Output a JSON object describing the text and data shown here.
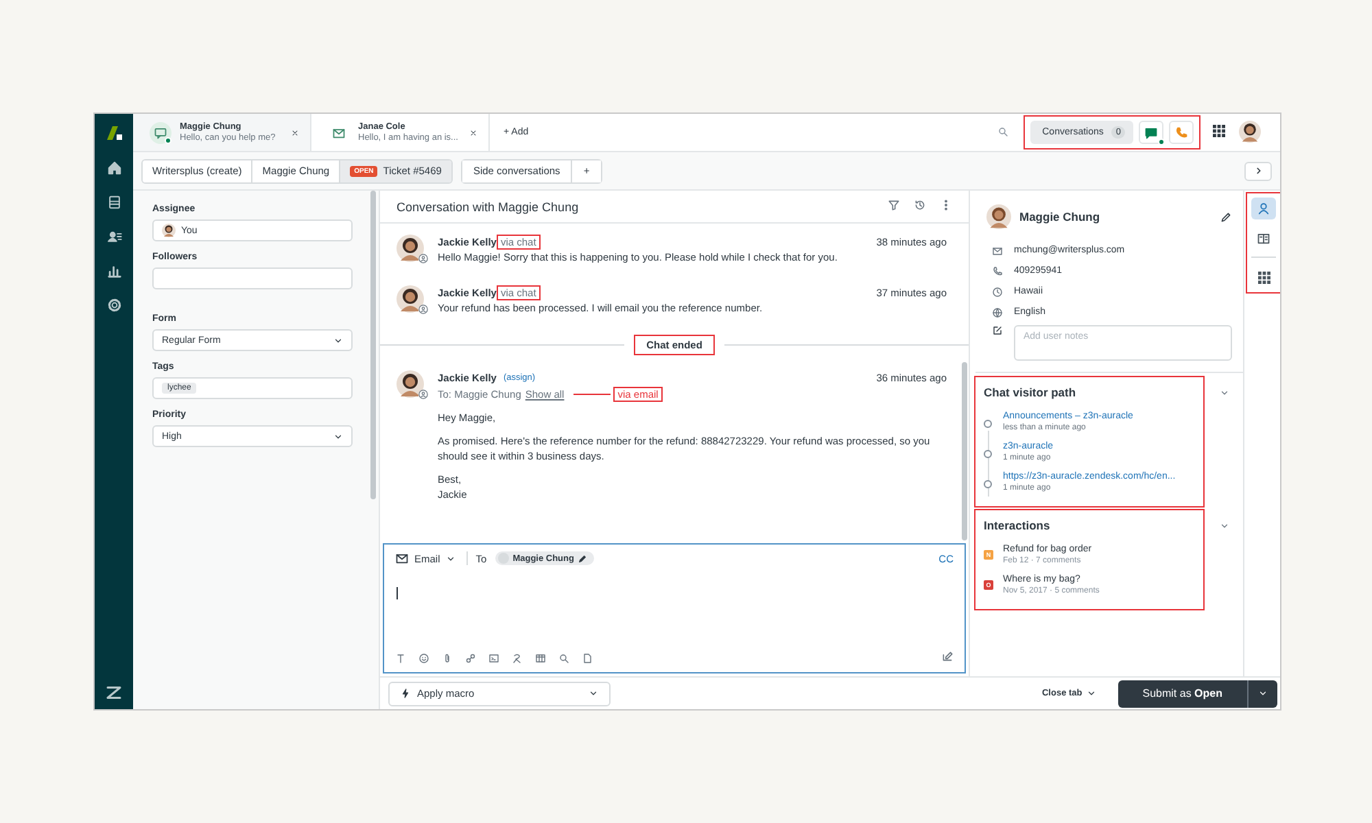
{
  "tabs": [
    {
      "kind": "chat",
      "title": "Maggie Chung",
      "preview": "Hello, can you help me?",
      "selected": true,
      "online": true
    },
    {
      "kind": "email",
      "title": "Janae Cole",
      "preview": "Hello, I am having an is...",
      "selected": false,
      "online": false
    }
  ],
  "add_tab": "+ Add",
  "conversations": {
    "label": "Conversations",
    "count": "0",
    "highlighted": true,
    "chat_online": true
  },
  "breadcrumbs": [
    {
      "label": "Writersplus (create)",
      "selected": false
    },
    {
      "label": "Maggie Chung",
      "selected": false
    },
    {
      "label": "Ticket #5469",
      "badge": "OPEN",
      "selected": true
    }
  ],
  "side_conversations": {
    "label": "Side conversations",
    "add": "+"
  },
  "properties": [
    {
      "kind": "person",
      "label": "Assignee",
      "value": "You"
    },
    {
      "kind": "text",
      "label": "Followers"
    },
    {
      "kind": "select",
      "label": "Form",
      "value": "Regular Form"
    },
    {
      "kind": "tags",
      "label": "Tags",
      "tags": [
        "lychee"
      ]
    },
    {
      "kind": "select",
      "label": "Priority",
      "value": "High"
    }
  ],
  "conversation": {
    "title": "Conversation with Maggie Chung",
    "messages": [
      {
        "kind": "chat",
        "author": "Jackie Kelly",
        "via": "via chat",
        "via_highlighted": true,
        "time": "38 minutes ago",
        "text": "Hello Maggie! Sorry that this is happening to you. Please hold while I check that for you."
      },
      {
        "kind": "chat",
        "author": "Jackie Kelly",
        "via": "via chat",
        "via_highlighted": true,
        "time": "37 minutes ago",
        "text": "Your refund has been processed. I will email you the reference number."
      },
      {
        "kind": "divider",
        "text": "Chat ended",
        "highlighted": true
      },
      {
        "kind": "email",
        "author": "Jackie Kelly",
        "assign": "(assign)",
        "time": "36 minutes ago",
        "to": "To: Maggie Chung",
        "show_all": "Show all",
        "via": "via email",
        "via_highlighted": true,
        "paragraphs": [
          [
            "Hey Maggie,"
          ],
          [
            "As promised. Here's the reference number for the refund: 88842723229. Your refund was processed, so you should see it within 3 business days."
          ],
          [
            "Best,",
            "Jackie"
          ]
        ]
      }
    ]
  },
  "composer": {
    "channel": "Email",
    "to_label": "To",
    "recipient": "Maggie Chung",
    "cc": "CC"
  },
  "macro": "Apply macro",
  "close_tab": "Close tab",
  "submit": "Submit as **Open**",
  "user": {
    "name": "Maggie Chung",
    "details": [
      {
        "kind": "email",
        "text": "mchung@writersplus.com"
      },
      {
        "kind": "phone",
        "text": "409295941"
      },
      {
        "kind": "timezone",
        "text": "Hawaii"
      },
      {
        "kind": "language",
        "text": "English"
      }
    ],
    "notes_placeholder": "Add user notes"
  },
  "visitor_path": {
    "title": "Chat visitor path",
    "highlighted": true,
    "entries": [
      {
        "link": "Announcements – z3n-auracle",
        "time": "less than a minute ago"
      },
      {
        "link": "z3n-auracle",
        "time": "1 minute ago"
      },
      {
        "link": "https://z3n-auracle.zendesk.com/hc/en...",
        "time": "1 minute ago"
      }
    ]
  },
  "interactions": {
    "title": "Interactions",
    "highlighted": true,
    "items": [
      {
        "badge": "N",
        "color": "#f5a243",
        "title": "Refund for bag order",
        "meta": "Feb 12 · 7 comments"
      },
      {
        "badge": "O",
        "color": "#d9403a",
        "title": "Where is my bag?",
        "meta": "Nov 5, 2017 · 5 comments"
      }
    ]
  },
  "rail": {
    "highlighted": true,
    "items": [
      {
        "kind": "user",
        "selected": true
      },
      {
        "kind": "book",
        "selected": false
      },
      {
        "kind": "apps",
        "selected": false
      }
    ]
  }
}
